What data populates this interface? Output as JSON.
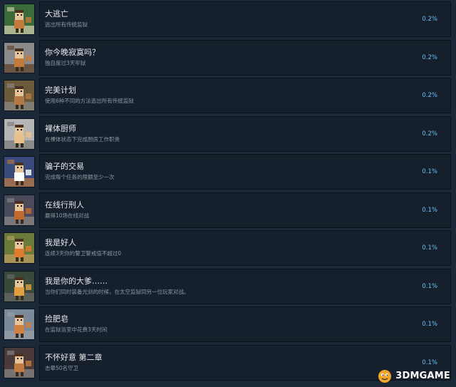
{
  "achievements": [
    {
      "title": "大逃亡",
      "desc": "逃出所有传统监狱",
      "percent": "0.2%",
      "icon": "escape-group-icon",
      "colors": [
        "#3b6b3a",
        "#c47a3c",
        "#d9d2b0"
      ]
    },
    {
      "title": "你今晚寂寞吗？",
      "desc": "独自度过3天牢狱",
      "percent": "0.2%",
      "icon": "lonely-prisoner-icon",
      "colors": [
        "#8a8a8a",
        "#c27a3a",
        "#5a3e2a"
      ]
    },
    {
      "title": "完美计划",
      "desc": "使用6种不同的方法逃出所有传统监狱",
      "percent": "0.2%",
      "icon": "bicycle-icon",
      "colors": [
        "#6b5b3a",
        "#b37a45",
        "#8a8a8a"
      ]
    },
    {
      "title": "裸体厨师",
      "desc": "在裸体状态下完成厨房工作职责",
      "percent": "0.2%",
      "icon": "naked-chef-icon",
      "colors": [
        "#b5b5b5",
        "#e8c08a",
        "#777777"
      ]
    },
    {
      "title": "骗子的交易",
      "desc": "完成每个任务的限额至少一次",
      "percent": "0.1%",
      "icon": "con-man-icon",
      "colors": [
        "#3a4a7a",
        "#ffffff",
        "#c07a40"
      ]
    },
    {
      "title": "在线行刑人",
      "desc": "赢得10场在线对战",
      "percent": "0.1%",
      "icon": "online-executioner-icon",
      "colors": [
        "#4a4a5a",
        "#c06a30",
        "#8a8a8a"
      ]
    },
    {
      "title": "我是好人",
      "desc": "连续3天你的警卫警戒值不超过0",
      "percent": "0.1%",
      "icon": "good-guy-icon",
      "colors": [
        "#6a7a3a",
        "#e07a30",
        "#c0a060"
      ]
    },
    {
      "title": "我是你的大爹……",
      "desc": "当你们同时装备光剑的时候，在太空监狱同另一位玩家对战。",
      "percent": "0.1%",
      "icon": "space-duel-icon",
      "colors": [
        "#3a4a3a",
        "#e0a040",
        "#6a6a6a"
      ]
    },
    {
      "title": "捡肥皂",
      "desc": "在监狱浴室中花费3天时间",
      "percent": "0.1%",
      "icon": "soap-icon",
      "colors": [
        "#7a8a9a",
        "#d08040",
        "#9aa0a6"
      ]
    },
    {
      "title": "不怀好意 第二章",
      "desc": "击晕50名守卫",
      "percent": "0.1%",
      "icon": "knockout-guard-icon",
      "colors": [
        "#4a3a3a",
        "#c07a40",
        "#8a8a8a"
      ]
    }
  ],
  "watermark": {
    "text": "3DMGAME",
    "icon": "3dm-logo-icon"
  }
}
